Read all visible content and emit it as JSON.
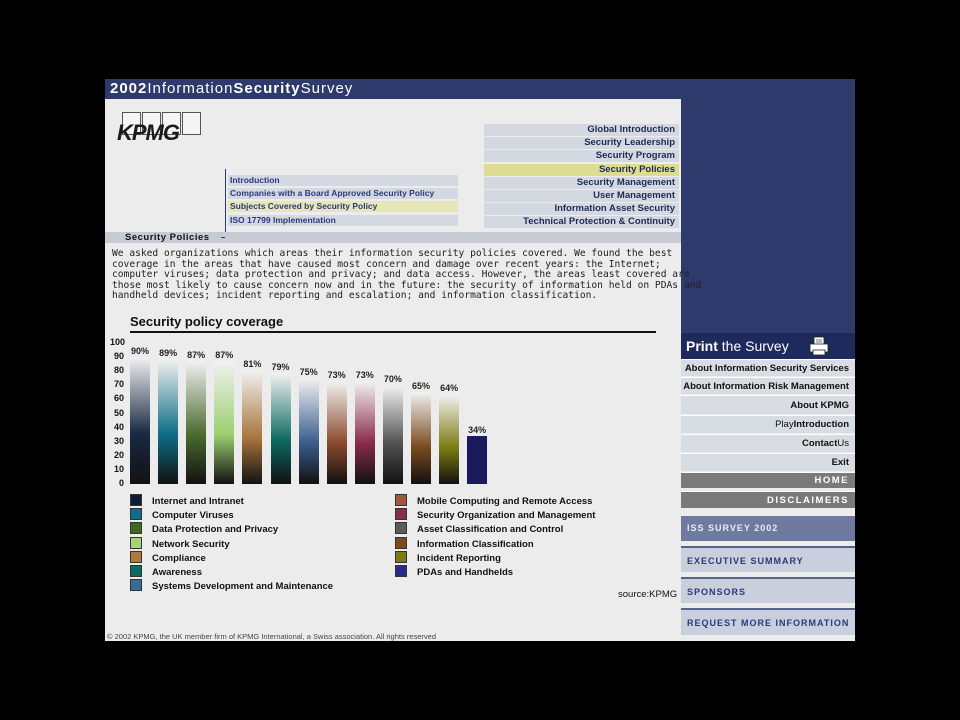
{
  "header": {
    "title_part1": "2002",
    "title_part2": "Information",
    "title_part3": "Security",
    "title_part4": "Survey"
  },
  "logo": {
    "text": "KPMG"
  },
  "right_nav": [
    {
      "label": "Global Introduction",
      "active": false
    },
    {
      "label": "Security Leadership",
      "active": false
    },
    {
      "label": "Security Program",
      "active": false
    },
    {
      "label": "Security Policies",
      "active": true
    },
    {
      "label": "Security Management",
      "active": false
    },
    {
      "label": "User Management",
      "active": false
    },
    {
      "label": "Information Asset Security",
      "active": false
    },
    {
      "label": "Technical Protection & Continuity",
      "active": false
    }
  ],
  "sub_nav": [
    {
      "label": "Introduction",
      "active": false
    },
    {
      "label": "Companies with a Board Approved Security Policy",
      "active": false
    },
    {
      "label": "Subjects Covered by Security Policy",
      "active": true
    },
    {
      "label": "ISO 17799 Implementation",
      "active": false
    }
  ],
  "section": {
    "title": "Security Policies"
  },
  "intro_lines": [
    "We asked organizations which areas their information security policies covered. We found the best",
    "coverage in the areas that have caused most concern and damage over recent years: the Internet;",
    "computer viruses; data protection and privacy; and data access. However, the areas least covered are",
    "those most likely to cause concern now and in the future: the security of information held on PDAs and",
    "handheld devices; incident reporting and escalation; and information classification."
  ],
  "chart_data": {
    "type": "bar",
    "title": "Security policy coverage",
    "y_ticks": [
      "100",
      "90",
      "80",
      "70",
      "60",
      "50",
      "40",
      "30",
      "20",
      "10",
      "0"
    ],
    "ylim": [
      0,
      100
    ],
    "categories": [
      "Internet and Intranet",
      "Computer Viruses",
      "Data Protection and Privacy",
      "Network Security",
      "Compliance",
      "Awareness",
      "Systems Development and Maintenance",
      "Mobile Computing and Remote Access",
      "Security Organization and Management",
      "Asset Classification and Control",
      "Information Classification",
      "Incident Reporting",
      "PDAs and Handhelds"
    ],
    "values": [
      90,
      89,
      87,
      87,
      81,
      79,
      75,
      73,
      73,
      70,
      65,
      64,
      34
    ],
    "value_labels": [
      "90%",
      "89%",
      "87%",
      "87%",
      "81%",
      "79%",
      "75%",
      "73%",
      "73%",
      "70%",
      "65%",
      "64%",
      "34%"
    ],
    "colors": [
      "#1a2a44",
      "#0d6e86",
      "#4a6b2f",
      "#9bcf6e",
      "#a8743b",
      "#0d6b63",
      "#3c5f8f",
      "#8b4a2e",
      "#8a2c4a",
      "#4f4f4f",
      "#7a4a1f",
      "#7b7b12",
      "#1a1a5c"
    ],
    "legend_left": [
      "Internet and Intranet",
      "Computer Viruses",
      "Data Protection and Privacy",
      "Network Security",
      "Compliance",
      "Awareness",
      "Systems Development and Maintenance"
    ],
    "legend_right": [
      "Mobile Computing and Remote Access",
      "Security Organization and Management",
      "Asset Classification and Control",
      "Information Classification",
      "Incident Reporting",
      "PDAs and Handhelds"
    ],
    "legend_left_colors": [
      "#0f1d33",
      "#0d6e86",
      "#3c6b24",
      "#a6d670",
      "#b07a3a",
      "#0d6b63",
      "#3a6a9a"
    ],
    "legend_right_colors": [
      "#a0583a",
      "#8a2c4a",
      "#5a5a5a",
      "#7a4a1f",
      "#7b7b12",
      "#2a2a8a"
    ]
  },
  "source": "source:KPMG",
  "copyright": "© 2002 KPMG, the UK member firm of KPMG International, a Swiss association. All rights reserved",
  "print": {
    "bold": "Print",
    "rest": " the Survey"
  },
  "side_menu": {
    "about_iss": "About Information Security Services",
    "about_irm": "About Information Risk Management",
    "about_kpmg": "About KPMG",
    "play_a": "Play",
    "play_b": "Introduction",
    "contact_a": "Contact",
    "contact_b": "Us",
    "exit": "Exit",
    "home": "HOME",
    "disclaimers": "DISCLAIMERS"
  },
  "side_blocks": [
    "ISS SURVEY 2002",
    "EXECUTIVE SUMMARY",
    "SPONSORS",
    "REQUEST MORE INFORMATION"
  ]
}
